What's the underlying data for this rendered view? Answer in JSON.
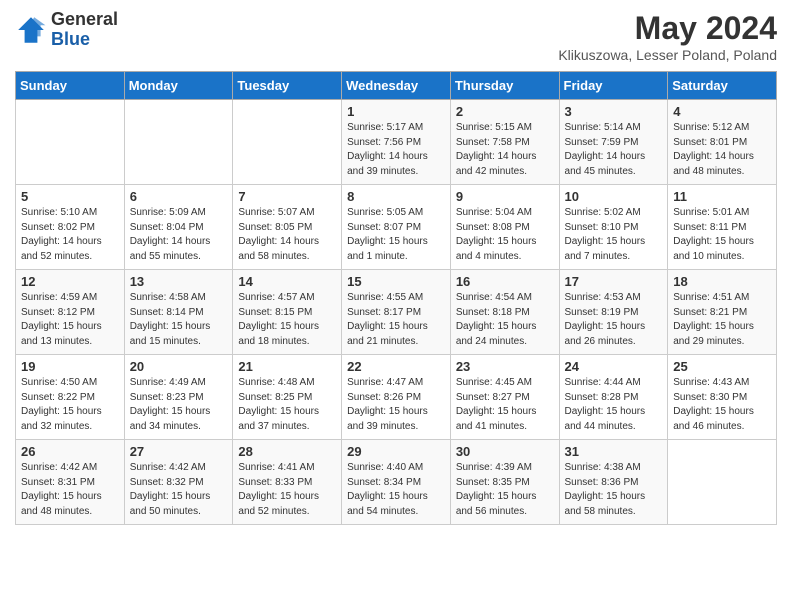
{
  "header": {
    "logo_general": "General",
    "logo_blue": "Blue",
    "title": "May 2024",
    "subtitle": "Klikuszowa, Lesser Poland, Poland"
  },
  "days_of_week": [
    "Sunday",
    "Monday",
    "Tuesday",
    "Wednesday",
    "Thursday",
    "Friday",
    "Saturday"
  ],
  "weeks": [
    [
      null,
      null,
      null,
      {
        "day": "1",
        "sunrise": "5:17 AM",
        "sunset": "7:56 PM",
        "daylight": "14 hours and 39 minutes."
      },
      {
        "day": "2",
        "sunrise": "5:15 AM",
        "sunset": "7:58 PM",
        "daylight": "14 hours and 42 minutes."
      },
      {
        "day": "3",
        "sunrise": "5:14 AM",
        "sunset": "7:59 PM",
        "daylight": "14 hours and 45 minutes."
      },
      {
        "day": "4",
        "sunrise": "5:12 AM",
        "sunset": "8:01 PM",
        "daylight": "14 hours and 48 minutes."
      }
    ],
    [
      {
        "day": "5",
        "sunrise": "5:10 AM",
        "sunset": "8:02 PM",
        "daylight": "14 hours and 52 minutes."
      },
      {
        "day": "6",
        "sunrise": "5:09 AM",
        "sunset": "8:04 PM",
        "daylight": "14 hours and 55 minutes."
      },
      {
        "day": "7",
        "sunrise": "5:07 AM",
        "sunset": "8:05 PM",
        "daylight": "14 hours and 58 minutes."
      },
      {
        "day": "8",
        "sunrise": "5:05 AM",
        "sunset": "8:07 PM",
        "daylight": "15 hours and 1 minute."
      },
      {
        "day": "9",
        "sunrise": "5:04 AM",
        "sunset": "8:08 PM",
        "daylight": "15 hours and 4 minutes."
      },
      {
        "day": "10",
        "sunrise": "5:02 AM",
        "sunset": "8:10 PM",
        "daylight": "15 hours and 7 minutes."
      },
      {
        "day": "11",
        "sunrise": "5:01 AM",
        "sunset": "8:11 PM",
        "daylight": "15 hours and 10 minutes."
      }
    ],
    [
      {
        "day": "12",
        "sunrise": "4:59 AM",
        "sunset": "8:12 PM",
        "daylight": "15 hours and 13 minutes."
      },
      {
        "day": "13",
        "sunrise": "4:58 AM",
        "sunset": "8:14 PM",
        "daylight": "15 hours and 15 minutes."
      },
      {
        "day": "14",
        "sunrise": "4:57 AM",
        "sunset": "8:15 PM",
        "daylight": "15 hours and 18 minutes."
      },
      {
        "day": "15",
        "sunrise": "4:55 AM",
        "sunset": "8:17 PM",
        "daylight": "15 hours and 21 minutes."
      },
      {
        "day": "16",
        "sunrise": "4:54 AM",
        "sunset": "8:18 PM",
        "daylight": "15 hours and 24 minutes."
      },
      {
        "day": "17",
        "sunrise": "4:53 AM",
        "sunset": "8:19 PM",
        "daylight": "15 hours and 26 minutes."
      },
      {
        "day": "18",
        "sunrise": "4:51 AM",
        "sunset": "8:21 PM",
        "daylight": "15 hours and 29 minutes."
      }
    ],
    [
      {
        "day": "19",
        "sunrise": "4:50 AM",
        "sunset": "8:22 PM",
        "daylight": "15 hours and 32 minutes."
      },
      {
        "day": "20",
        "sunrise": "4:49 AM",
        "sunset": "8:23 PM",
        "daylight": "15 hours and 34 minutes."
      },
      {
        "day": "21",
        "sunrise": "4:48 AM",
        "sunset": "8:25 PM",
        "daylight": "15 hours and 37 minutes."
      },
      {
        "day": "22",
        "sunrise": "4:47 AM",
        "sunset": "8:26 PM",
        "daylight": "15 hours and 39 minutes."
      },
      {
        "day": "23",
        "sunrise": "4:45 AM",
        "sunset": "8:27 PM",
        "daylight": "15 hours and 41 minutes."
      },
      {
        "day": "24",
        "sunrise": "4:44 AM",
        "sunset": "8:28 PM",
        "daylight": "15 hours and 44 minutes."
      },
      {
        "day": "25",
        "sunrise": "4:43 AM",
        "sunset": "8:30 PM",
        "daylight": "15 hours and 46 minutes."
      }
    ],
    [
      {
        "day": "26",
        "sunrise": "4:42 AM",
        "sunset": "8:31 PM",
        "daylight": "15 hours and 48 minutes."
      },
      {
        "day": "27",
        "sunrise": "4:42 AM",
        "sunset": "8:32 PM",
        "daylight": "15 hours and 50 minutes."
      },
      {
        "day": "28",
        "sunrise": "4:41 AM",
        "sunset": "8:33 PM",
        "daylight": "15 hours and 52 minutes."
      },
      {
        "day": "29",
        "sunrise": "4:40 AM",
        "sunset": "8:34 PM",
        "daylight": "15 hours and 54 minutes."
      },
      {
        "day": "30",
        "sunrise": "4:39 AM",
        "sunset": "8:35 PM",
        "daylight": "15 hours and 56 minutes."
      },
      {
        "day": "31",
        "sunrise": "4:38 AM",
        "sunset": "8:36 PM",
        "daylight": "15 hours and 58 minutes."
      },
      null
    ]
  ],
  "labels": {
    "sunrise": "Sunrise:",
    "sunset": "Sunset:",
    "daylight": "Daylight:"
  }
}
